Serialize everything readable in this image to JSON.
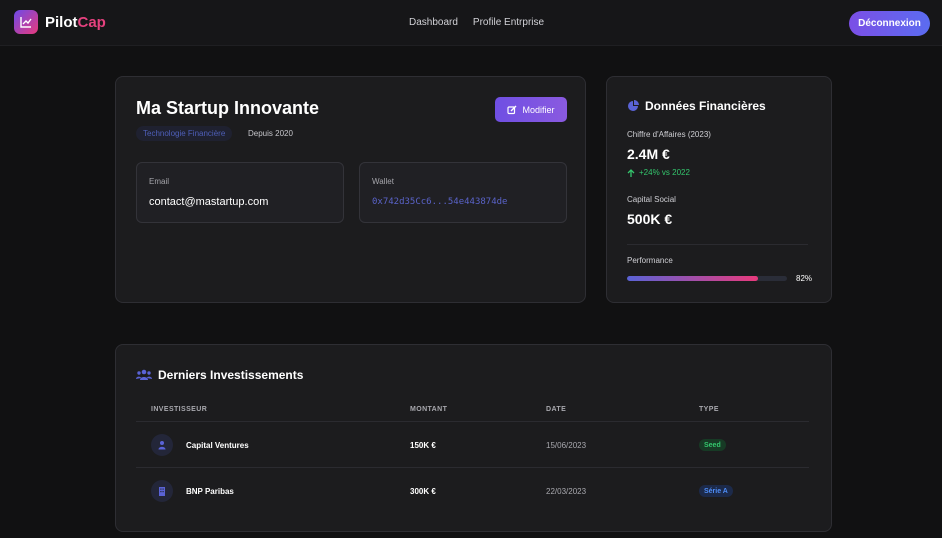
{
  "nav": {
    "brand_part1": "Pilot",
    "brand_part2": "Cap",
    "links": [
      "Dashboard",
      "Profile Entrprise"
    ],
    "logout_label": "Déconnexion"
  },
  "profile": {
    "name": "Ma Startup Innovante",
    "industry": "Technologie Financière",
    "since": "Depuis 2020",
    "edit_label": "Modifier",
    "email_label": "Email",
    "email": "contact@mastartup.com",
    "wallet_label": "Wallet",
    "wallet": "0x742d35Cc6...54e443874de"
  },
  "finance": {
    "title": "Données Financières",
    "revenue_label": "Chiffre d'Affaires (2023)",
    "revenue_value": "2.4M €",
    "revenue_delta": "+24% vs 2022",
    "capital_label": "Capital Social",
    "capital_value": "500K €",
    "performance_label": "Performance",
    "performance_text": "82%",
    "performance_fraction": 0.82
  },
  "investments": {
    "title": "Derniers Investissements",
    "headers": [
      "INVESTISSEUR",
      "MONTANT",
      "DATE",
      "TYPE"
    ],
    "rows": [
      {
        "investor": "Capital Ventures",
        "amount": "150K €",
        "date": "15/06/2023",
        "type": "Seed",
        "icon": "user-icon"
      },
      {
        "investor": "BNP Paribas",
        "amount": "300K €",
        "date": "22/03/2023",
        "type": "Série A",
        "icon": "building-icon"
      }
    ]
  },
  "colors": {
    "accent_purple": "#7b4fe6",
    "accent_pink": "#e83a7c",
    "positive_green": "#34c66d",
    "seed_bg": "#173a25",
    "seed_fg": "#34c66d",
    "seriesA_bg": "#1c2a4a",
    "seriesA_fg": "#4f8ef7"
  }
}
